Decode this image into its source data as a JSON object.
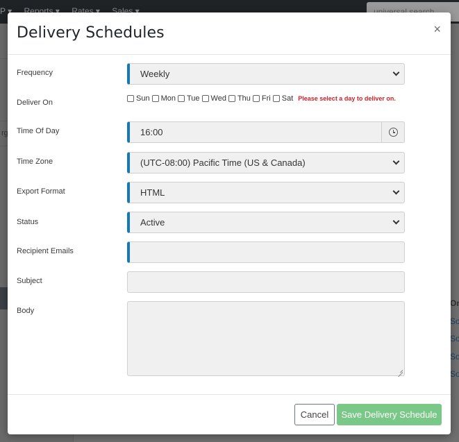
{
  "background": {
    "nav_items": [
      "P ▾",
      "Reports ▾",
      "Rates ▾",
      "Sales ▾"
    ],
    "search_placeholder": "universal search",
    "sidebar_fragment": "rga",
    "table_header_fragment": "Or",
    "table_links": [
      "So",
      "So",
      "So",
      "So"
    ]
  },
  "modal": {
    "title": "Delivery Schedules",
    "close_glyph": "×",
    "fields": {
      "frequency": {
        "label": "Frequency",
        "value": "Weekly"
      },
      "deliver_on": {
        "label": "Deliver On",
        "days": [
          "Sun",
          "Mon",
          "Tue",
          "Wed",
          "Thu",
          "Fri",
          "Sat"
        ],
        "error": "Please select a day to deliver on."
      },
      "time_of_day": {
        "label": "Time Of Day",
        "value": "16:00"
      },
      "time_zone": {
        "label": "Time Zone",
        "value": "(UTC-08:00) Pacific Time (US & Canada)"
      },
      "export_format": {
        "label": "Export Format",
        "value": "HTML"
      },
      "status": {
        "label": "Status",
        "value": "Active"
      },
      "recipient_emails": {
        "label": "Recipient Emails",
        "value": ""
      },
      "subject": {
        "label": "Subject",
        "value": ""
      },
      "body": {
        "label": "Body",
        "value": ""
      }
    },
    "footer": {
      "cancel_label": "Cancel",
      "save_label": "Save Delivery Schedule"
    }
  },
  "colors": {
    "required_accent": "#1479b8",
    "save_button": "#79c887",
    "error_text": "#d0202a"
  },
  "icons": [
    "close-icon",
    "chevron-down-icon",
    "clock-icon"
  ]
}
